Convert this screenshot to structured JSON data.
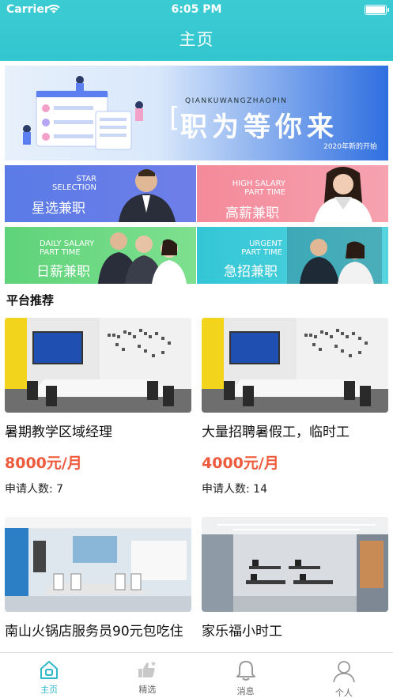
{
  "status_bar": {
    "carrier": "Carrier",
    "time": "6:05 PM"
  },
  "header": {
    "title": "主页"
  },
  "banner": {
    "pinyin": "QIANKUWANGZHAOPIN",
    "slogan": "职为等你来",
    "sub": "2020年新的开始"
  },
  "tiles": [
    {
      "en1": "STAR",
      "en2": "SELECTION",
      "cn": "星选兼职"
    },
    {
      "en1": "HIGH SALARY",
      "en2": "PART TIME",
      "cn": "高薪兼职"
    },
    {
      "en1": "DAILY SALARY",
      "en2": "PART TIME",
      "cn": "日薪兼职"
    },
    {
      "en1": "URGENT",
      "en2": "PART TIME",
      "cn": "急招兼职"
    }
  ],
  "section": {
    "title": "平台推荐"
  },
  "jobs": [
    {
      "name": "暑期教学区域经理",
      "salary": "8000元/月",
      "applicants": "申请人数: 7"
    },
    {
      "name": "大量招聘暑假工，临时工",
      "salary": "4000元/月",
      "applicants": "申请人数: 14"
    },
    {
      "name": "南山火锅店服务员90元包吃住",
      "salary": "",
      "applicants": ""
    },
    {
      "name": "家乐福小时工",
      "salary": "",
      "applicants": ""
    }
  ],
  "tabbar": [
    {
      "label": "主页",
      "icon": "home-icon"
    },
    {
      "label": "精选",
      "icon": "thumbs-up-icon"
    },
    {
      "label": "消息",
      "icon": "bell-icon"
    },
    {
      "label": "个人",
      "icon": "person-icon"
    }
  ],
  "colors": {
    "accent": "#33c6cf",
    "salary": "#ee5a3c"
  }
}
